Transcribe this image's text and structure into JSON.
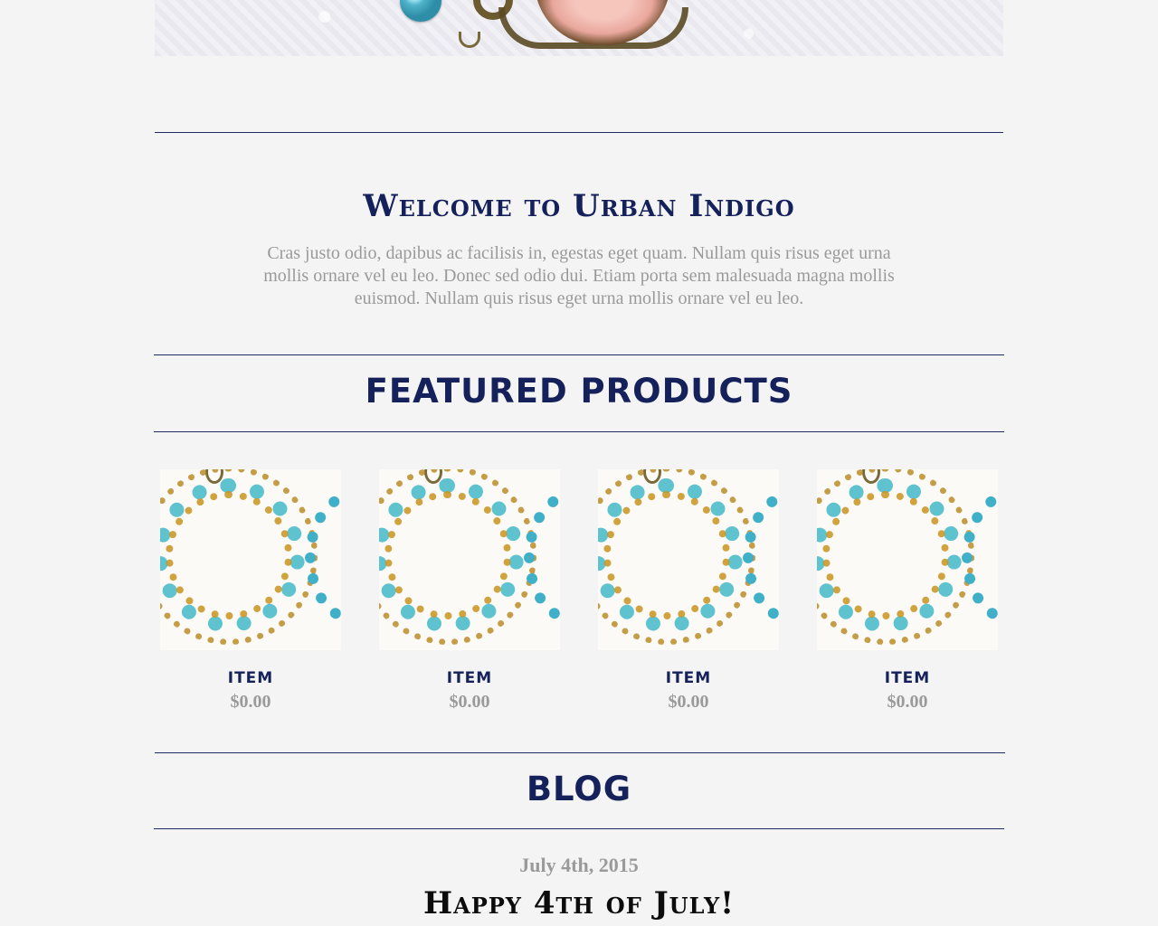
{
  "welcome": {
    "title": "Welcome to Urban Indigo",
    "text": "Cras justo odio, dapibus ac facilisis in, egestas eget quam. Nullam quis risus eget urna mollis ornare vel eu leo. Donec sed odio dui. Etiam porta sem malesuada magna mollis euismod. Nullam quis risus eget urna mollis ornare vel eu leo."
  },
  "featured": {
    "title": "FEATURED PRODUCTS",
    "products": [
      {
        "name": "ITEM",
        "price": "$0.00",
        "image": "turquoise-earrings-image"
      },
      {
        "name": "ITEM",
        "price": "$0.00",
        "image": "turquoise-earrings-image"
      },
      {
        "name": "ITEM",
        "price": "$0.00",
        "image": "turquoise-earrings-image"
      },
      {
        "name": "ITEM",
        "price": "$0.00",
        "image": "turquoise-earrings-image"
      }
    ]
  },
  "blog": {
    "title": "BLOG",
    "post": {
      "date": "July 4th, 2015",
      "title": "Happy 4th of July!"
    }
  },
  "colors": {
    "accent": "#15215a",
    "muted_text": "#9a9a9a",
    "background": "#f4f4f4"
  }
}
